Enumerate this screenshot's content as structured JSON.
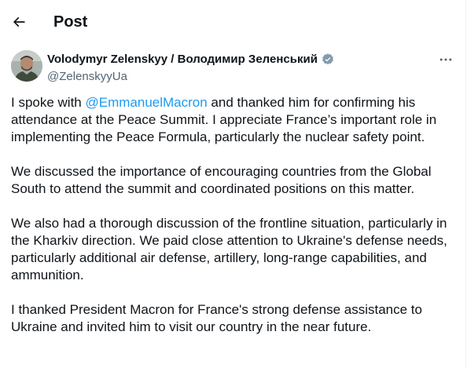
{
  "header": {
    "back_icon": "arrow-left-icon",
    "title": "Post"
  },
  "author": {
    "avatar_icon": "avatar-photo",
    "display_name": "Volodymyr Zelenskyy / Володимир Зеленський",
    "verified_icon": "verified-badge-icon",
    "handle": "@ZelenskyyUa",
    "more_icon": "more-horizontal-icon"
  },
  "tweet": {
    "p1_before": "I spoke with ",
    "p1_mention": "@EmmanuelMacron",
    "p1_after": " and thanked him for confirming his attendance at the Peace Summit. I appreciate France’s important role in implementing the Peace Formula, particularly the nuclear safety point.",
    "p2": "We discussed the importance of encouraging countries from the Global South to attend the summit and coordinated positions on this matter.",
    "p3": "We also had a thorough discussion of the frontline situation, particularly in the Kharkiv direction. We paid close attention to Ukraine's defense needs, particularly additional air defense, artillery, long-range capabilities, and ammunition.",
    "p4": "I thanked President Macron for France's strong defense assistance to Ukraine and invited him to visit our country in the near future."
  },
  "colors": {
    "accent": "#1d9bf0",
    "text": "#0f1419",
    "secondary_text": "#536471"
  }
}
